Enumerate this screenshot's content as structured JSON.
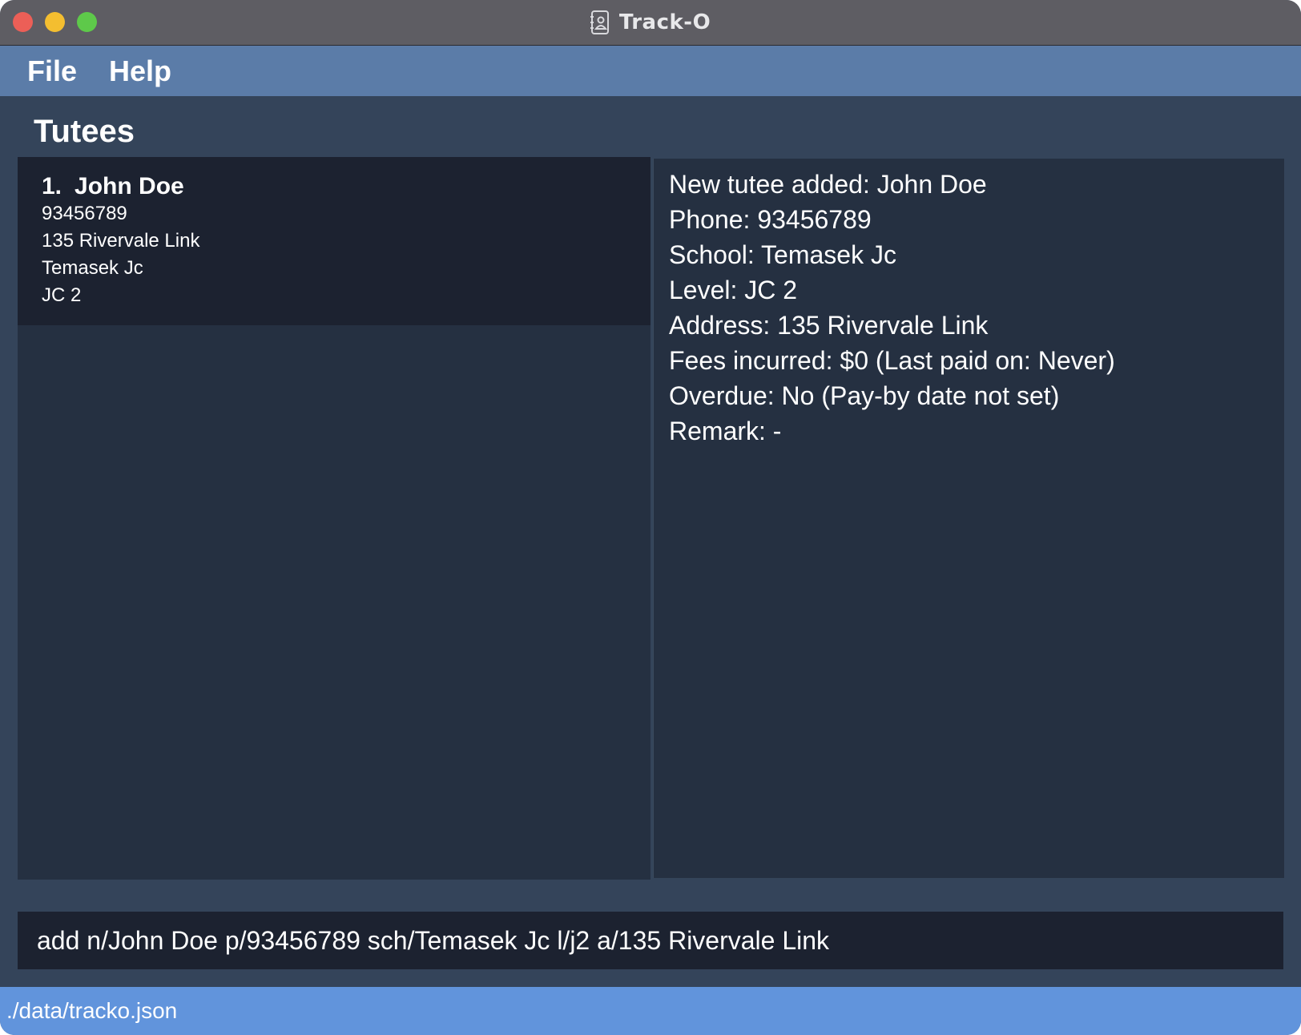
{
  "window": {
    "title": "Track-O",
    "icon": "address-book-icon"
  },
  "menu": {
    "items": [
      "File",
      "Help"
    ]
  },
  "tutees": {
    "heading": "Tutees",
    "list": [
      {
        "index": "1.",
        "name": "John Doe",
        "phone": "93456789",
        "address": "135 Rivervale Link",
        "school": "Temasek Jc",
        "level": "JC 2"
      }
    ]
  },
  "result": {
    "lines": [
      "New tutee added: John Doe",
      "Phone: 93456789",
      "School: Temasek Jc",
      "Level: JC 2",
      "Address: 135 Rivervale Link",
      "Fees incurred: $0 (Last paid on: Never)",
      "Overdue: No (Pay-by date not set)",
      "Remark: -"
    ]
  },
  "command": {
    "value": "add n/John Doe p/93456789 sch/Temasek Jc l/j2 a/135 Rivervale Link"
  },
  "status": {
    "file_path": "./data/tracko.json"
  },
  "colors": {
    "titlebar": "#5e5d63",
    "menubar": "#5b7ca8",
    "background": "#34445a",
    "panel": "#253041",
    "selected_card": "#1c2230",
    "statusbar": "#6194dc"
  }
}
